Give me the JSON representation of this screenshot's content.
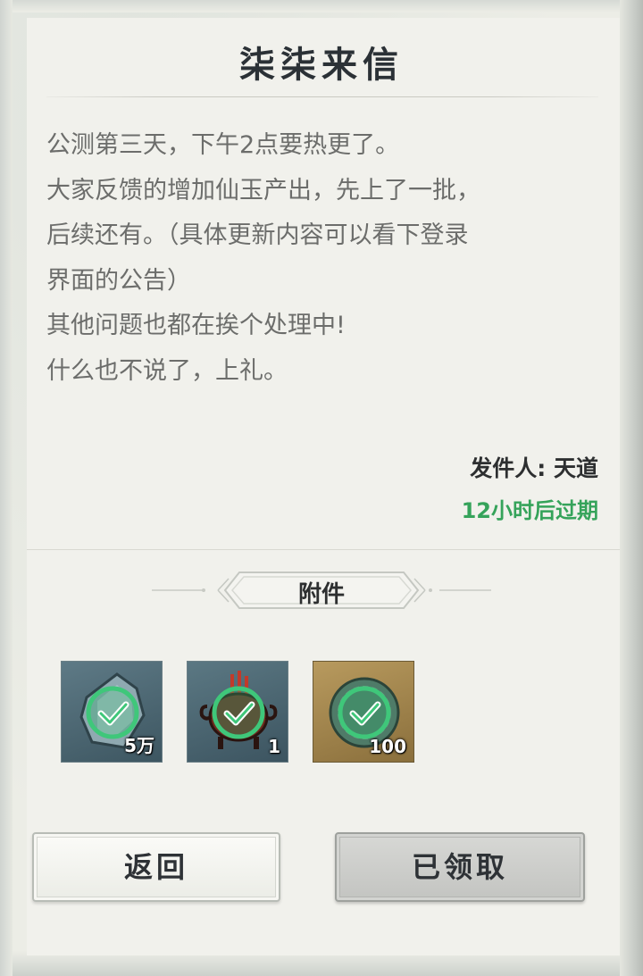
{
  "mail": {
    "title": "柒柒来信",
    "lines": [
      "公测第三天，下午2点要热更了。",
      "大家反馈的增加仙玉产出，先上了一批，",
      "后续还有。（具体更新内容可以看下登录",
      "界面的公告）",
      "其他问题也都在挨个处理中!",
      "什么也不说了，上礼。"
    ],
    "sender": "发件人: 天道",
    "expiry": "12小时后过期"
  },
  "attachments": {
    "label": "附件",
    "items": [
      {
        "icon": "crystal-ore-icon",
        "count": "5万",
        "claimed": true
      },
      {
        "icon": "incense-burner-icon",
        "count": "1",
        "claimed": true
      },
      {
        "icon": "jade-disc-icon",
        "count": "100",
        "claimed": true
      }
    ]
  },
  "buttons": {
    "back": "返回",
    "claimed": "已领取"
  },
  "colors": {
    "title": "#2b3136",
    "body_text": "#6c6d6b",
    "expiry_green": "#35a35a",
    "check_green": "#3fc77a"
  }
}
